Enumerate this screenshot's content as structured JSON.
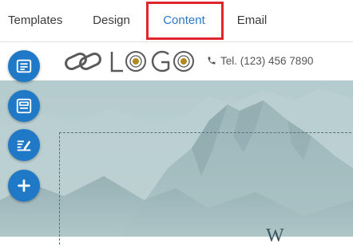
{
  "tabs": [
    {
      "label": "Templates",
      "active": false
    },
    {
      "label": "Design",
      "active": false
    },
    {
      "label": "Content",
      "active": true
    },
    {
      "label": "Email",
      "active": false
    }
  ],
  "header": {
    "logo_text": "LOGO",
    "phone": "Tel. (123) 456 7890"
  },
  "hero": {
    "partial_text": "W"
  },
  "side_buttons": [
    {
      "icon": "layout-icon"
    },
    {
      "icon": "section-icon"
    },
    {
      "icon": "edit-text-icon"
    },
    {
      "icon": "plus-icon"
    }
  ],
  "colors": {
    "accent": "#2a78c5",
    "button": "#1f79c6",
    "highlight": "#e0262c",
    "logo_gold": "#b08a1a"
  }
}
